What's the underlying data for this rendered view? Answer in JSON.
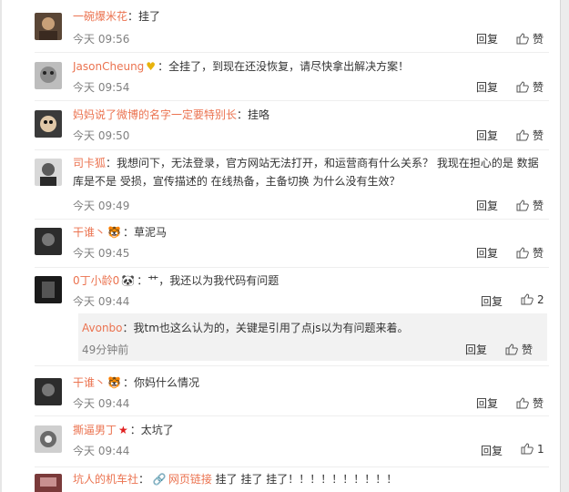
{
  "comments": [
    {
      "name": "一碗爆米花",
      "colon": "：",
      "text": "挂了",
      "time": "今天 09:56",
      "reply": "回复",
      "like": "赞",
      "avatar_color": "#5a4636"
    },
    {
      "name": "JasonCheung",
      "badge": "♥",
      "colon": "：",
      "text": "全挂了，到现在还没恢复，请尽快拿出解决方案！",
      "time": "今天 09:54",
      "reply": "回复",
      "like": "赞",
      "avatar_color": "#9a9a9a"
    },
    {
      "name": "妈妈说了微博的名字一定要特别长",
      "colon": "：",
      "text": "挂咯",
      "time": "今天 09:50",
      "reply": "回复",
      "like": "赞",
      "avatar_color": "#3a3a3a"
    },
    {
      "name": "司卡狐",
      "colon": "：",
      "text": "我想问下，无法登录，官方网站无法打开，和运营商有什么关系？ 我现在担心的是 数据库是不是 受损，宣传描述的 在线热备，主备切换 为什么没有生效？",
      "time": "今天 09:49",
      "reply": "回复",
      "like": "赞",
      "avatar_color": "#6b6b6b"
    },
    {
      "name": "干谁丶",
      "badge": "🐯",
      "colon": "：",
      "text": "草泥马",
      "time": "今天 09:45",
      "reply": "回复",
      "like": "赞",
      "avatar_color": "#2c2c2c"
    },
    {
      "name": "0丁小龄0",
      "badge": "🐼",
      "colon": "：",
      "text": "艹，我还以为我代码有问题",
      "time": "今天 09:44",
      "reply": "回复",
      "like": "2",
      "avatar_color": "#1a1a1a"
    },
    {
      "name": "干谁丶",
      "badge": "🐯",
      "colon": "：",
      "text": "你妈什么情况",
      "time": "今天 09:44",
      "reply": "回复",
      "like": "赞",
      "avatar_color": "#2c2c2c"
    },
    {
      "name": "撕逼男丁",
      "badge": "★",
      "colon": "：",
      "text": "太坑了",
      "time": "今天 09:44",
      "reply": "回复",
      "like": "1",
      "avatar_color": "#8e8e8e"
    },
    {
      "name": "坑人的机车社",
      "colon": "：",
      "link_icon": "🔗",
      "link_text": "网页链接",
      "text": " 挂了 挂了 挂了！！！！！！！！！！",
      "avatar_color": "#7a3a3a"
    }
  ],
  "subreply": {
    "name": "Avonbo",
    "colon": "：",
    "text": "我tm也这么认为的，关键是引用了点js以为有问题来着。",
    "time": "49分钟前",
    "reply": "回复",
    "like": "赞"
  }
}
